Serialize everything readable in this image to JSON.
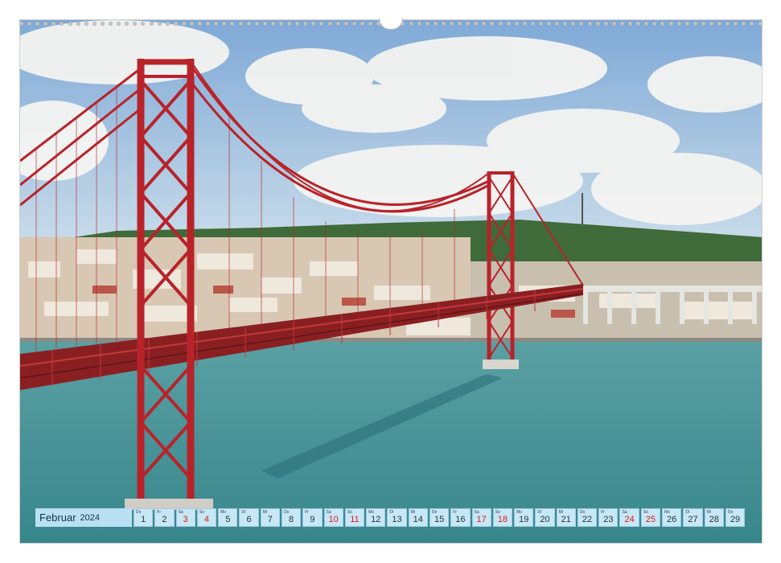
{
  "calendar": {
    "month": "Februar",
    "year": "2024",
    "weekend_color": "#d21d1d",
    "strip_color": "#c8e7f5",
    "days": [
      {
        "day_name": "Do",
        "num": "1",
        "weekend": false
      },
      {
        "day_name": "Fr",
        "num": "2",
        "weekend": false
      },
      {
        "day_name": "Sa",
        "num": "3",
        "weekend": true
      },
      {
        "day_name": "So",
        "num": "4",
        "weekend": true
      },
      {
        "day_name": "Mo",
        "num": "5",
        "weekend": false
      },
      {
        "day_name": "Di",
        "num": "6",
        "weekend": false
      },
      {
        "day_name": "Mi",
        "num": "7",
        "weekend": false
      },
      {
        "day_name": "Do",
        "num": "8",
        "weekend": false
      },
      {
        "day_name": "Fr",
        "num": "9",
        "weekend": false
      },
      {
        "day_name": "Sa",
        "num": "10",
        "weekend": true
      },
      {
        "day_name": "So",
        "num": "11",
        "weekend": true
      },
      {
        "day_name": "Mo",
        "num": "12",
        "weekend": false
      },
      {
        "day_name": "Di",
        "num": "13",
        "weekend": false
      },
      {
        "day_name": "Mi",
        "num": "14",
        "weekend": false
      },
      {
        "day_name": "Do",
        "num": "15",
        "weekend": false
      },
      {
        "day_name": "Fr",
        "num": "16",
        "weekend": false
      },
      {
        "day_name": "Sa",
        "num": "17",
        "weekend": true
      },
      {
        "day_name": "So",
        "num": "18",
        "weekend": true
      },
      {
        "day_name": "Mo",
        "num": "19",
        "weekend": false
      },
      {
        "day_name": "Di",
        "num": "20",
        "weekend": false
      },
      {
        "day_name": "Mi",
        "num": "21",
        "weekend": false
      },
      {
        "day_name": "Do",
        "num": "22",
        "weekend": false
      },
      {
        "day_name": "Fr",
        "num": "23",
        "weekend": false
      },
      {
        "day_name": "Sa",
        "num": "24",
        "weekend": true
      },
      {
        "day_name": "So",
        "num": "25",
        "weekend": true
      },
      {
        "day_name": "Mo",
        "num": "26",
        "weekend": false
      },
      {
        "day_name": "Di",
        "num": "27",
        "weekend": false
      },
      {
        "day_name": "Mi",
        "num": "28",
        "weekend": false
      },
      {
        "day_name": "Do",
        "num": "29",
        "weekend": false
      }
    ]
  },
  "photo": {
    "subject": "suspension-bridge-over-river",
    "bridge_color": "#b8232a",
    "water_color": "#3f8f93",
    "sky_color": "#8fb6dc"
  }
}
